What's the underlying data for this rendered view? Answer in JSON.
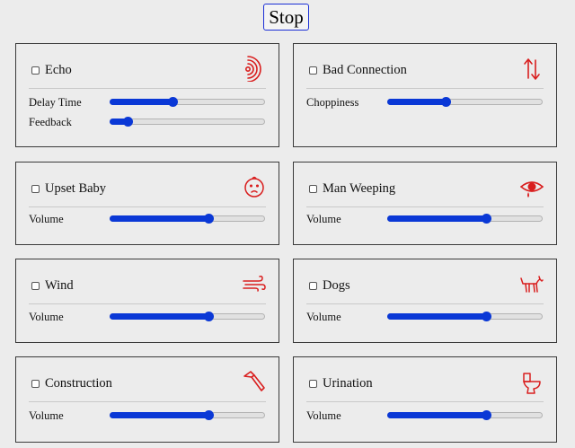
{
  "stop_button": {
    "label": "Stop"
  },
  "cards": [
    {
      "title": "Echo",
      "icon": "echo-icon",
      "checked": false,
      "controls": [
        {
          "label": "Delay Time",
          "value": 0.41
        },
        {
          "label": "Feedback",
          "value": 0.12
        }
      ]
    },
    {
      "title": "Bad Connection",
      "icon": "up-down-arrows-icon",
      "checked": false,
      "controls": [
        {
          "label": "Choppiness",
          "value": 0.38
        }
      ]
    },
    {
      "title": "Upset Baby",
      "icon": "baby-face-icon",
      "checked": false,
      "controls": [
        {
          "label": "Volume",
          "value": 0.64
        }
      ]
    },
    {
      "title": "Man Weeping",
      "icon": "weeping-eye-icon",
      "checked": false,
      "controls": [
        {
          "label": "Volume",
          "value": 0.64
        }
      ]
    },
    {
      "title": "Wind",
      "icon": "wind-icon",
      "checked": false,
      "controls": [
        {
          "label": "Volume",
          "value": 0.64
        }
      ]
    },
    {
      "title": "Dogs",
      "icon": "dog-icon",
      "checked": false,
      "controls": [
        {
          "label": "Volume",
          "value": 0.64
        }
      ]
    },
    {
      "title": "Construction",
      "icon": "hammer-icon",
      "checked": false,
      "controls": [
        {
          "label": "Volume",
          "value": 0.64
        }
      ]
    },
    {
      "title": "Urination",
      "icon": "toilet-icon",
      "checked": false,
      "controls": [
        {
          "label": "Volume",
          "value": 0.64
        }
      ]
    }
  ],
  "colors": {
    "accent": "#0a38d6",
    "icon_red": "#d91e1e",
    "stop_border": "#1b2fd6"
  }
}
